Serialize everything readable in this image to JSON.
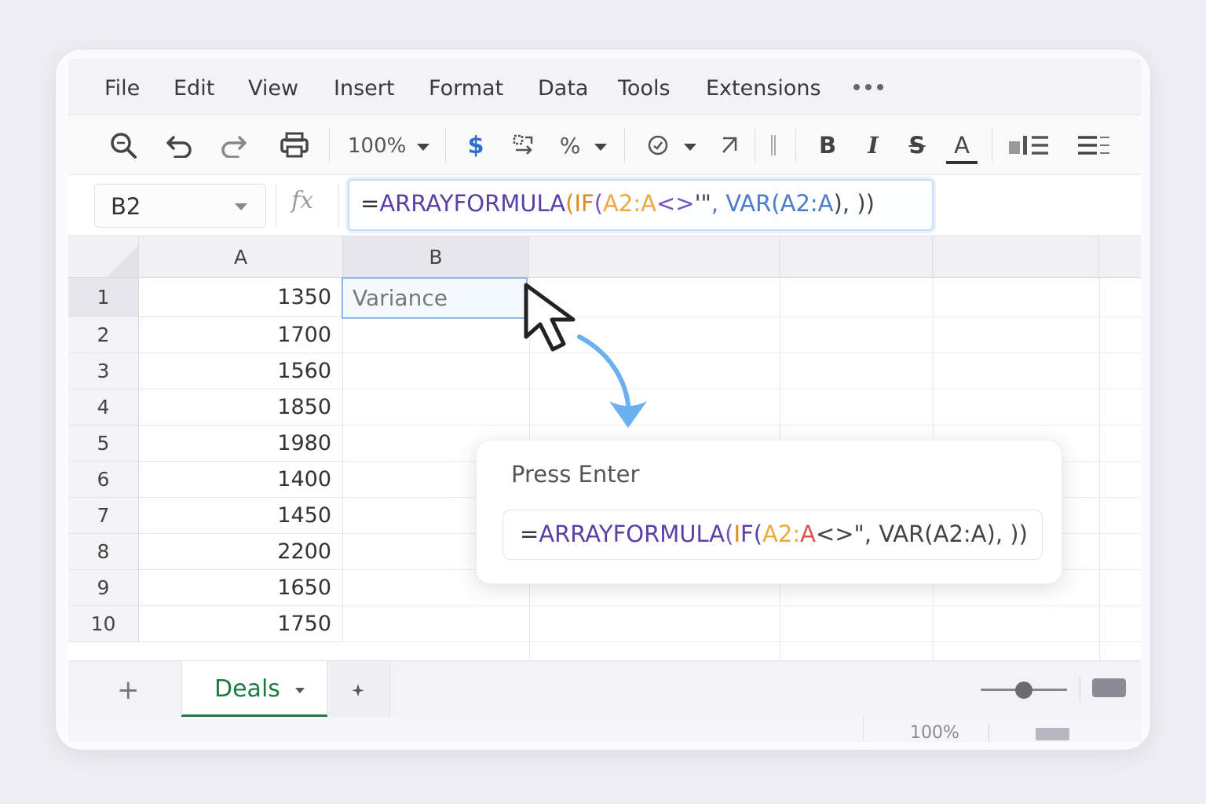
{
  "menu": {
    "items": [
      "File",
      "Edit",
      "View",
      "Insert",
      "Format",
      "Data",
      "Tools",
      "Extensions"
    ]
  },
  "toolbar": {
    "zoom": "100%",
    "currency_symbol": "$",
    "percent_symbol": "%",
    "bold_label": "B",
    "italic_label": "I",
    "strike_label": "S",
    "text_color_label": "A"
  },
  "formula_bar": {
    "cell_ref": "B2",
    "fx_label": "fx",
    "formula_parts": {
      "eq": "=",
      "fn": "ARRAYFORMULA",
      "open1": "(",
      "if": "IF",
      "open2": "(",
      "ref1": "A2:A",
      "op": "<>",
      "quote": "'\"",
      "rest": ", VAR(",
      "ref2": "A2:A",
      "close": "), ))"
    }
  },
  "grid": {
    "columns": [
      "A",
      "B"
    ],
    "row_numbers": [
      "1",
      "2",
      "3",
      "4",
      "5",
      "6",
      "7",
      "8",
      "9",
      "10"
    ],
    "column_a": [
      "1350",
      "1700",
      "1560",
      "1850",
      "1980",
      "1400",
      "1450",
      "2200",
      "1650",
      "1750"
    ],
    "b1": "Variance"
  },
  "popup": {
    "title": "Press Enter",
    "formula_parts": {
      "eq": "=",
      "fn": "ARRAYFORMULA",
      "open1": "(",
      "if_i": "I",
      "if_f": "F(",
      "ref1": "A2:",
      "ref1b": "A",
      "rest": "<>\", VAR(A2:A), ))"
    }
  },
  "sheets": {
    "add_label": "+",
    "active": "Deals"
  },
  "status": {
    "zoom": "100%"
  }
}
